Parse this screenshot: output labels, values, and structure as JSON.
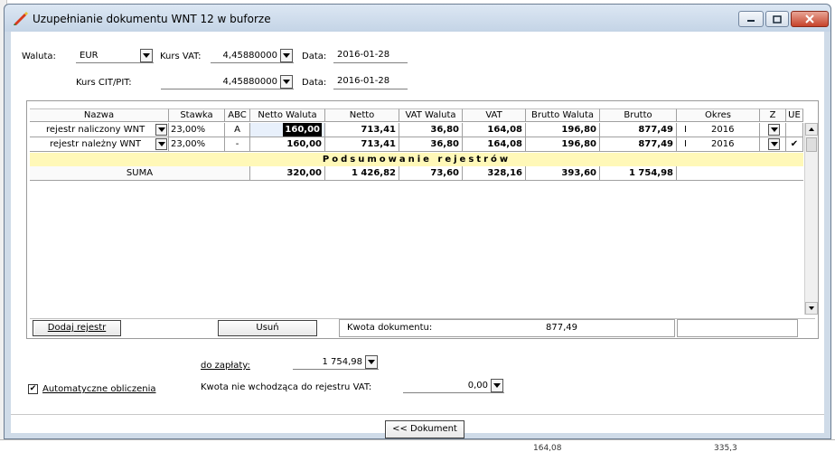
{
  "window": {
    "title": "Uzupełnianie dokumentu WNT 12 w buforze"
  },
  "header": {
    "waluta_label": "Waluta:",
    "waluta_value": "EUR",
    "kurs_vat_label": "Kurs VAT:",
    "kurs_vat_value": "4,45880000",
    "data1_label": "Data:",
    "data1_value": "2016-01-28",
    "kurs_cit_label": "Kurs CIT/PIT:",
    "kurs_cit_value": "4,45880000",
    "data2_label": "Data:",
    "data2_value": "2016-01-28"
  },
  "grid": {
    "columns": [
      "Nazwa",
      "Stawka",
      "ABC",
      "Netto Waluta",
      "Netto",
      "VAT Waluta",
      "VAT",
      "Brutto Waluta",
      "Brutto",
      "Okres",
      "Z",
      "UE"
    ],
    "rows": [
      {
        "nazwa": "rejestr naliczony WNT",
        "stawka": "23,00%",
        "abc": "A",
        "netto_waluta": "160,00",
        "netto": "713,41",
        "vat_waluta": "36,80",
        "vat": "164,08",
        "brutto_waluta": "196,80",
        "brutto": "877,49",
        "okres_m": "I",
        "okres_y": "2016",
        "ue": ""
      },
      {
        "nazwa": "rejestr należny WNT",
        "stawka": "23,00%",
        "abc": "-",
        "netto_waluta": "160,00",
        "netto": "713,41",
        "vat_waluta": "36,80",
        "vat": "164,08",
        "brutto_waluta": "196,80",
        "brutto": "877,49",
        "okres_m": "I",
        "okres_y": "2016",
        "ue": "✔"
      }
    ],
    "summary_title": "Podsumowanie rejestrów",
    "suma": {
      "label": "SUMA",
      "netto_waluta": "320,00",
      "netto": "1 426,82",
      "vat_waluta": "73,60",
      "vat": "328,16",
      "brutto_waluta": "393,60",
      "brutto": "1 754,98"
    }
  },
  "grid_footer": {
    "dodaj_label": "Dodaj rejestr",
    "usun_label": "Usuń",
    "kwota_label": "Kwota dokumentu:",
    "kwota_value": "877,49"
  },
  "bottom": {
    "do_zaplaty_label": "do zapłaty:",
    "do_zaplaty_value": "1 754,98",
    "auto_calc_label": "Automatyczne obliczenia",
    "auto_calc_checked": true,
    "kwota_nie_label": "Kwota nie wchodząca do rejestru VAT:",
    "kwota_nie_value": "0,00",
    "dokument_button": "<< Dokument"
  },
  "background": {
    "bottom_text_1": "164,08",
    "bottom_text_2": "335,3"
  },
  "colors": {
    "summary_bar": "#fff8b8",
    "window_frame": "#cfdbe8",
    "close_button": "#c7432a"
  }
}
